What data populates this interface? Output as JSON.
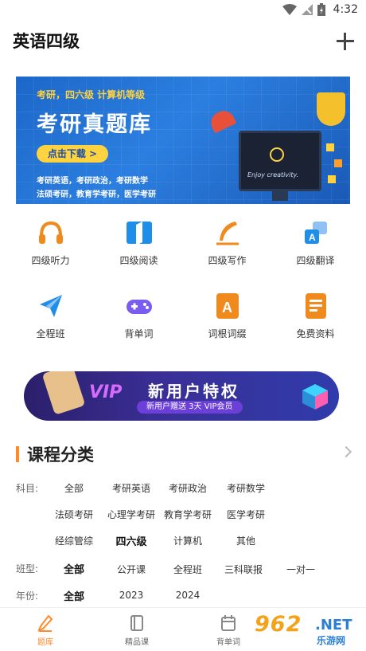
{
  "status": {
    "time": "4:32"
  },
  "header": {
    "title": "英语四级"
  },
  "banner": {
    "sub": "考研，四六级  计算机等级",
    "main": "考研真题库",
    "button": "点击下载 >",
    "line1": "考研英语，考研政治，考研数学",
    "line2": "法硕考研，教育学考研，医学考研",
    "monitor_text": "Enjoy creativity."
  },
  "grid": [
    {
      "label": "四级听力",
      "icon": "headphones-icon"
    },
    {
      "label": "四级阅读",
      "icon": "book-icon"
    },
    {
      "label": "四级写作",
      "icon": "pen-icon"
    },
    {
      "label": "四级翻译",
      "icon": "translate-icon"
    },
    {
      "label": "全程班",
      "icon": "paper-plane-icon"
    },
    {
      "label": "背单词",
      "icon": "gamepad-icon"
    },
    {
      "label": "词根词缀",
      "icon": "letter-a-icon"
    },
    {
      "label": "免费资料",
      "icon": "document-icon"
    }
  ],
  "promo": {
    "vip": "VIP",
    "title": "新用户特权",
    "sub": "新用户赠送 3天 VIP会员"
  },
  "category": {
    "title": "课程分类",
    "subject_label": "科目:",
    "subjects_row1": [
      "全部",
      "考研英语",
      "考研政治",
      "考研数学"
    ],
    "subjects_row2": [
      "法硕考研",
      "心理学考研",
      "教育学考研",
      "医学考研"
    ],
    "subjects_row3": [
      "经综管综",
      "四六级",
      "计算机",
      "其他"
    ],
    "class_label": "班型:",
    "classes": [
      "全部",
      "公开课",
      "全程班",
      "三科联报",
      "一对一"
    ],
    "year_label": "年份:",
    "years": [
      "全部",
      "2023",
      "2024"
    ]
  },
  "nav": [
    {
      "label": "题库",
      "active": true
    },
    {
      "label": "精品课",
      "active": false
    },
    {
      "label": "背单词",
      "active": false
    }
  ],
  "watermark": {
    "main": "962",
    "net": ".NET",
    "sub": "乐游网"
  },
  "colors": {
    "accent": "#ff8a2b",
    "banner_blue": "#1c67c9",
    "promo_purple": "#3a2f97"
  }
}
